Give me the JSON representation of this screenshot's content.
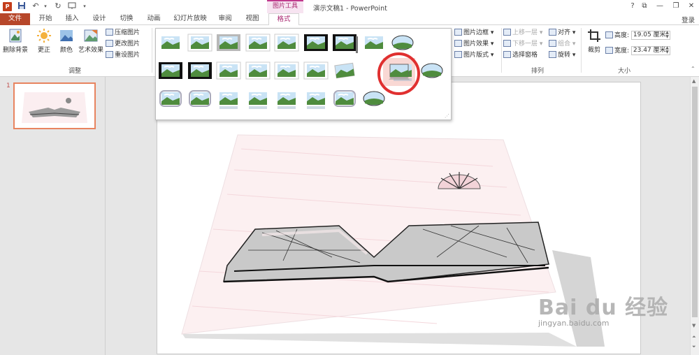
{
  "window": {
    "app_icon": "P",
    "title": "演示文稿1 - PowerPoint",
    "context_group": "图片工具",
    "help": "?",
    "restore": "⧉",
    "minimize": "—",
    "maximize": "❐",
    "close": "✕"
  },
  "quick_access": {
    "save_icon": "save-icon",
    "undo_icon": "undo-icon",
    "redo_icon": "redo-icon",
    "start_icon": "slideshow-icon",
    "dropdown": "▾"
  },
  "tabs": [
    "文件",
    "开始",
    "插入",
    "设计",
    "切换",
    "动画",
    "幻灯片放映",
    "审阅",
    "视图",
    "格式"
  ],
  "account": "登录",
  "ribbon": {
    "adjust": {
      "remove_bg": "删除背景",
      "corrections": "更正",
      "color": "颜色",
      "artistic": "艺术效果",
      "compress": "压缩图片",
      "change": "更改图片",
      "reset": "重设图片",
      "group": "调整"
    },
    "styles_right": {
      "border": "图片边框",
      "effects": "图片效果",
      "layout": "图片版式"
    },
    "arrange": {
      "forward": "上移一层",
      "backward": "下移一层",
      "pane": "选择窗格",
      "align": "对齐",
      "group_btn": "组合",
      "rotate": "旋转",
      "group": "排列"
    },
    "size": {
      "crop": "裁剪",
      "height_label": "高度:",
      "height_value": "19.05 厘米",
      "width_label": "宽度:",
      "width_value": "23.47 厘米",
      "group": "大小"
    }
  },
  "slides": {
    "number": "1"
  },
  "watermark": {
    "brand": "Bai  du 经验",
    "url": "jingyan.baidu.com"
  },
  "colors": {
    "file_tab": "#b7472a",
    "context_accent": "#a8256f",
    "highlight_circle": "#e03030",
    "thumb_border": "#e8845f"
  }
}
